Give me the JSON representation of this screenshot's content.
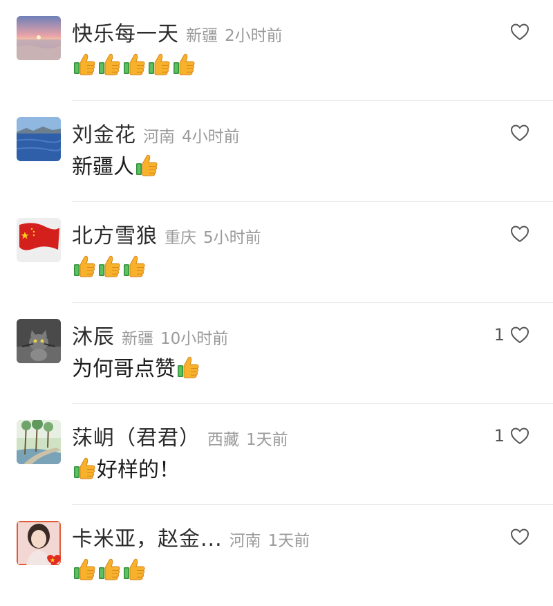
{
  "comments": [
    {
      "name": "快乐每一天",
      "location": "新疆",
      "time": "2小时前",
      "text": "",
      "thumbs": 5,
      "likes": "",
      "avatar": "sunset-avatar"
    },
    {
      "name": "刘金花",
      "location": "河南",
      "time": "4小时前",
      "text": "新疆人",
      "thumbs": 1,
      "likes": "",
      "avatar": "lake-avatar"
    },
    {
      "name": "北方雪狼",
      "location": "重庆",
      "time": "5小时前",
      "text": "",
      "thumbs": 3,
      "likes": "",
      "avatar": "red-flag-avatar"
    },
    {
      "name": "沐辰",
      "location": "新疆",
      "time": "10小时前",
      "text": "为何哥点赞",
      "thumbs": 1,
      "likes": "1",
      "avatar": "cat-avatar"
    },
    {
      "name": "莯岄（君君）",
      "location": "西藏",
      "time": "1天前",
      "text": "好样的！",
      "thumbs": 1,
      "thumbs_first": true,
      "likes": "1",
      "avatar": "riverside-avatar"
    },
    {
      "name": "卡米亚，赵金...",
      "location": "河南",
      "time": "1天前",
      "text": "",
      "thumbs": 3,
      "likes": "",
      "avatar": "woman-avatar"
    }
  ],
  "icons": {
    "like": "heart-outline-icon",
    "emoji": "thumbs-up-emoji"
  },
  "colors": {
    "name": "#2b2b2b",
    "meta": "#9a9a9a",
    "divider": "#e6e6e6",
    "thumb": "#f5a623",
    "heart_stroke": "#555555"
  }
}
